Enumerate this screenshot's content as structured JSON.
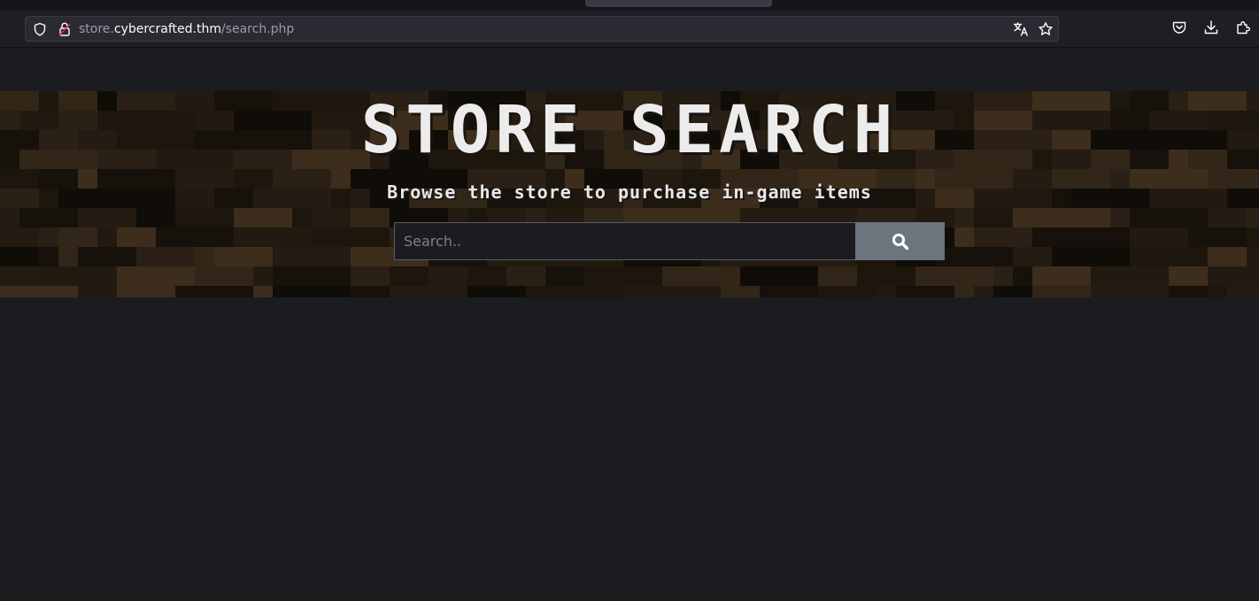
{
  "browser": {
    "url_prefix": "store.",
    "url_host": "cybercrafted.thm",
    "url_path": "/search.php",
    "icons": {
      "tracking_protection": "shield-icon",
      "connection": "lock-insecure-icon",
      "translate": "translate-icon",
      "bookmark": "star-icon",
      "pocket": "pocket-icon",
      "downloads": "download-icon",
      "extensions": "extensions-icon"
    }
  },
  "hero": {
    "title": "STORE SEARCH",
    "subtitle": "Browse the store to purchase in-game items"
  },
  "search": {
    "placeholder": "Search..",
    "value": "",
    "button_icon": "search-icon"
  },
  "colors": {
    "page_background": "#1b1c1f",
    "search_button": "#6c757d",
    "hero_wood": "#2a2014",
    "title_text": "#ececec"
  }
}
